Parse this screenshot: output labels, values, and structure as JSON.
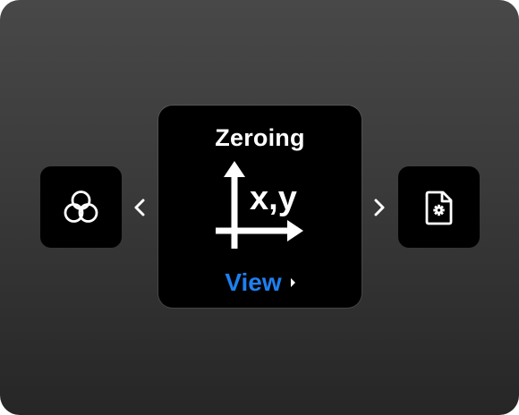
{
  "carousel": {
    "prev_item": {
      "icon": "color-circles-icon"
    },
    "current_item": {
      "title": "Zeroing",
      "icon": "xy-axes-icon",
      "icon_label": "x,y",
      "action_label": "View"
    },
    "next_item": {
      "icon": "document-settings-icon"
    },
    "prev_arrow": "chevron-left-icon",
    "next_arrow": "chevron-right-icon"
  },
  "colors": {
    "background_top": "#484848",
    "background_bottom": "#262626",
    "tile": "#000000",
    "text": "#ffffff",
    "accent": "#1f7ff0"
  }
}
